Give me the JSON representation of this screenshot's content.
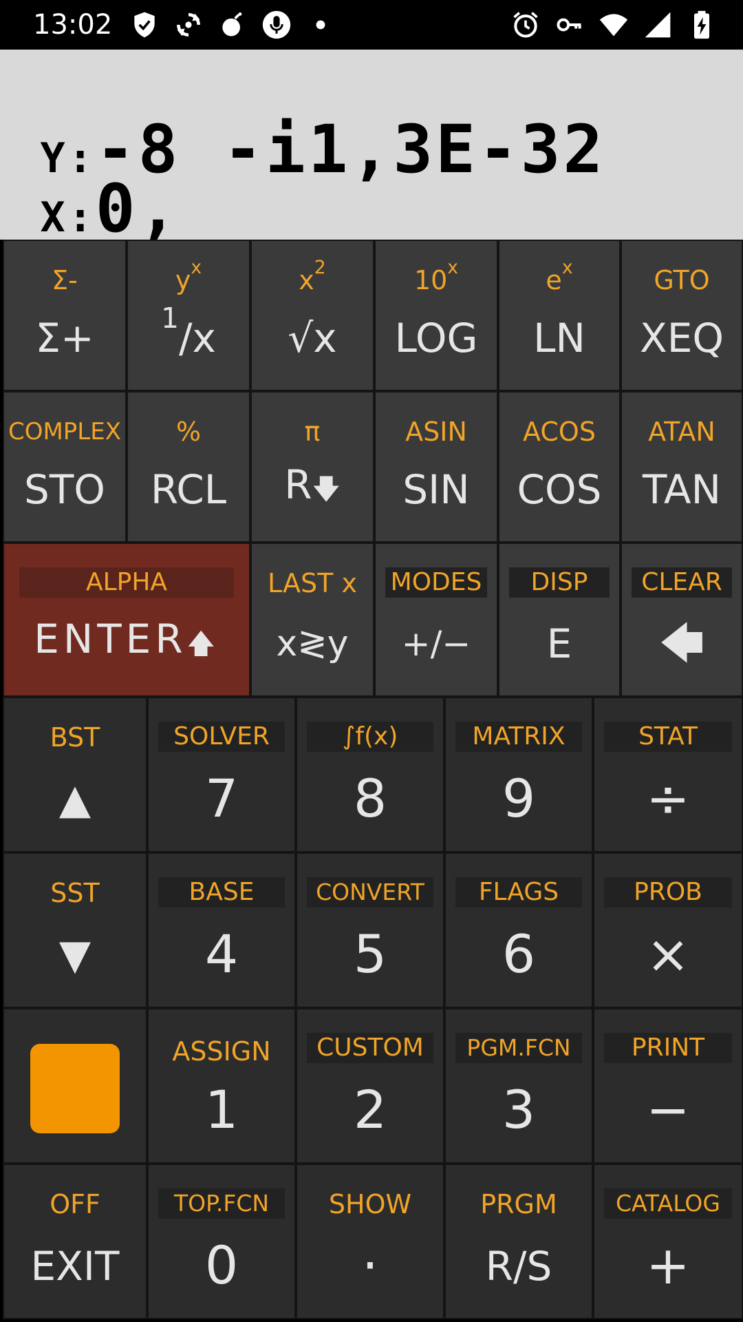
{
  "status_bar": {
    "time": "13:02",
    "left_icons": [
      "shield-icon",
      "sync-icon",
      "bomb-icon",
      "microphone-icon",
      "dot-icon"
    ],
    "right_icons": [
      "alarm-icon",
      "key-icon",
      "wifi-icon",
      "signal-icon",
      "battery-charging-icon"
    ]
  },
  "display": {
    "y_label": "Y:",
    "y_value": "-8 -i1,3E-32",
    "x_label": "X:",
    "x_value": "0,_"
  },
  "keys": {
    "sigma": {
      "shift": "Σ-",
      "main": "Σ+"
    },
    "inv": {
      "shift_base": "y",
      "shift_sup": "x",
      "main_base": "1",
      "main_rest": "/x"
    },
    "sqrt": {
      "shift_base": "x",
      "shift_sup": "2",
      "main": "√x"
    },
    "log": {
      "shift_base": "10",
      "shift_sup": "x",
      "main": "LOG"
    },
    "ln": {
      "shift_base": "e",
      "shift_sup": "x",
      "main": "LN"
    },
    "xeq": {
      "shift": "GTO",
      "main": "XEQ"
    },
    "sto": {
      "shift": "COMPLEX",
      "main": "STO"
    },
    "rcl": {
      "shift": "%",
      "main": "RCL"
    },
    "rdown": {
      "shift": "π",
      "main": "R",
      "main_arrow": "🡇"
    },
    "sin": {
      "shift": "ASIN",
      "main": "SIN"
    },
    "cos": {
      "shift": "ACOS",
      "main": "COS"
    },
    "tan": {
      "shift": "ATAN",
      "main": "TAN"
    },
    "enter": {
      "shift": "ALPHA",
      "main": "ENTER",
      "main_arrow": "🡅"
    },
    "xy": {
      "shift": "LAST x",
      "main": "x≷y"
    },
    "chs": {
      "shift": "MODES",
      "main": "+/−"
    },
    "e": {
      "shift": "DISP",
      "main": "E"
    },
    "back": {
      "shift": "CLEAR",
      "main": "🡄"
    },
    "up": {
      "shift": "BST",
      "main": "▲"
    },
    "k7": {
      "shift": "SOLVER",
      "main": "7"
    },
    "k8": {
      "shift": "∫f(x)",
      "main": "8"
    },
    "k9": {
      "shift": "MATRIX",
      "main": "9"
    },
    "div": {
      "shift": "STAT",
      "main": "÷"
    },
    "down": {
      "shift": "SST",
      "main": "▼"
    },
    "k4": {
      "shift": "BASE",
      "main": "4"
    },
    "k5": {
      "shift": "CONVERT",
      "main": "5"
    },
    "k6": {
      "shift": "FLAGS",
      "main": "6"
    },
    "mul": {
      "shift": "PROB",
      "main": "×"
    },
    "k1": {
      "shift": "ASSIGN",
      "main": "1"
    },
    "k2": {
      "shift": "CUSTOM",
      "main": "2"
    },
    "k3": {
      "shift": "PGM.FCN",
      "main": "3"
    },
    "sub": {
      "shift": "PRINT",
      "main": "−"
    },
    "exit": {
      "shift": "OFF",
      "main": "EXIT"
    },
    "k0": {
      "shift": "TOP.FCN",
      "main": "0"
    },
    "dot": {
      "shift": "SHOW",
      "main": "·"
    },
    "rs": {
      "shift": "PRGM",
      "main": "R/S"
    },
    "add": {
      "shift": "CATALOG",
      "main": "+"
    }
  },
  "colors": {
    "shift_label": "#f0a428",
    "shift_button": "#f29500",
    "enter_key": "#712a20",
    "display_bg": "#d9d9d9"
  }
}
